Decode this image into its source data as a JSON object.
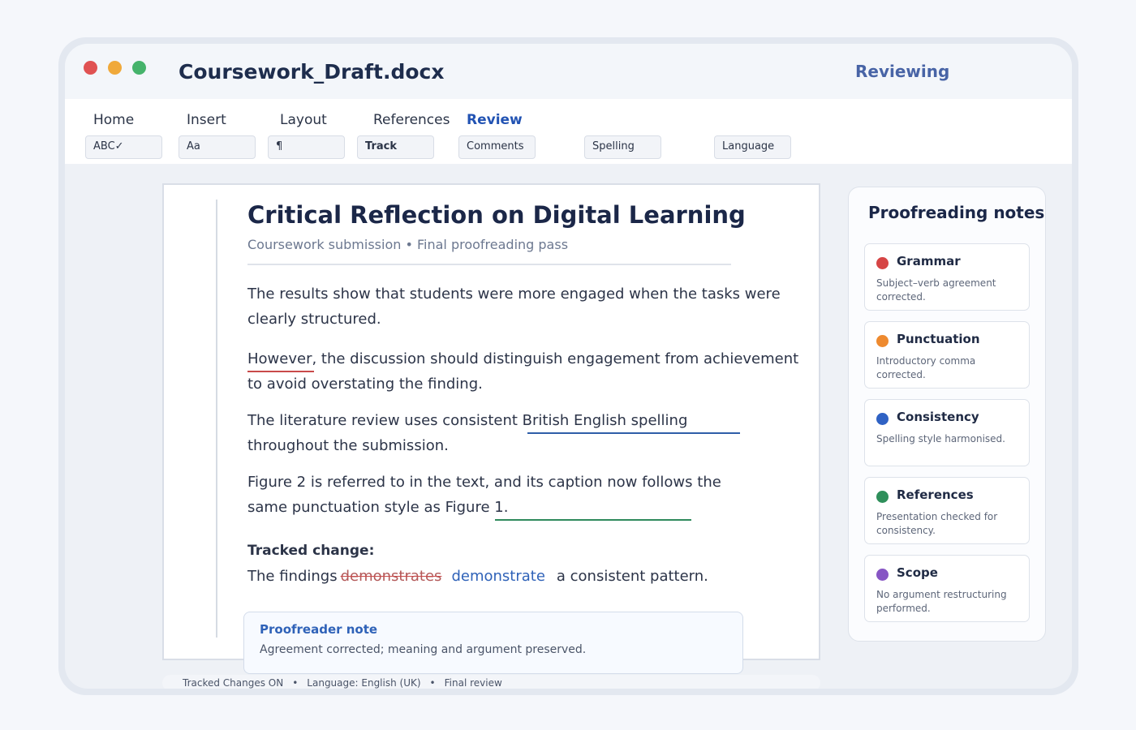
{
  "window": {
    "title": "Coursework_Draft.docx",
    "mode": "Reviewing"
  },
  "ribbon": {
    "menu": [
      "Home",
      "Insert",
      "Layout",
      "References",
      "Review"
    ],
    "active_menu": "Review",
    "tools": [
      "ABC✓",
      "Aa",
      "¶",
      "Track",
      "Comments",
      "Spelling",
      "Language"
    ]
  },
  "document": {
    "title": "Critical Reflection on Digital Learning",
    "subtitle": "Coursework submission • Final proofreading pass",
    "paragraphs": [
      "The results show that students were more engaged when the tasks were clearly structured.",
      "However, the discussion should distinguish engagement from achievement to avoid overstating the finding.",
      "The literature review uses consistent British English spelling throughout the submission.",
      "Figure 2 is referred to in the text, and its caption now follows the same punctuation style as Figure 1."
    ],
    "tracked_label": "Tracked change:",
    "tracked_prefix": "The findings",
    "tracked_deleted": "demonstrates",
    "tracked_inserted": "demonstrate",
    "tracked_suffix": "a consistent pattern."
  },
  "proofreader_note": {
    "title": "Proofreader note",
    "text": "Agreement corrected; meaning and argument preserved."
  },
  "status": [
    "Tracked Changes ON",
    "Language: English (UK)",
    "Final review"
  ],
  "panel": {
    "title": "Proofreading notes",
    "notes": [
      {
        "title": "Grammar",
        "text": "Subject–verb agreement corrected.",
        "color": "#d64545"
      },
      {
        "title": "Punctuation",
        "text": "Introductory comma corrected.",
        "color": "#ee8a2f"
      },
      {
        "title": "Consistency",
        "text": "Spelling style harmonised.",
        "color": "#2f62c4"
      },
      {
        "title": "References",
        "text": "Presentation checked for consistency.",
        "color": "#2f8f5b"
      },
      {
        "title": "Scope",
        "text": "No argument restructuring performed.",
        "color": "#8756c4"
      }
    ]
  },
  "colors": {
    "accent": "#2253b3",
    "grammar_underline": "#c94a4a",
    "consistency_underline": "#2f5ea8",
    "references_underline": "#2f8a5c"
  }
}
